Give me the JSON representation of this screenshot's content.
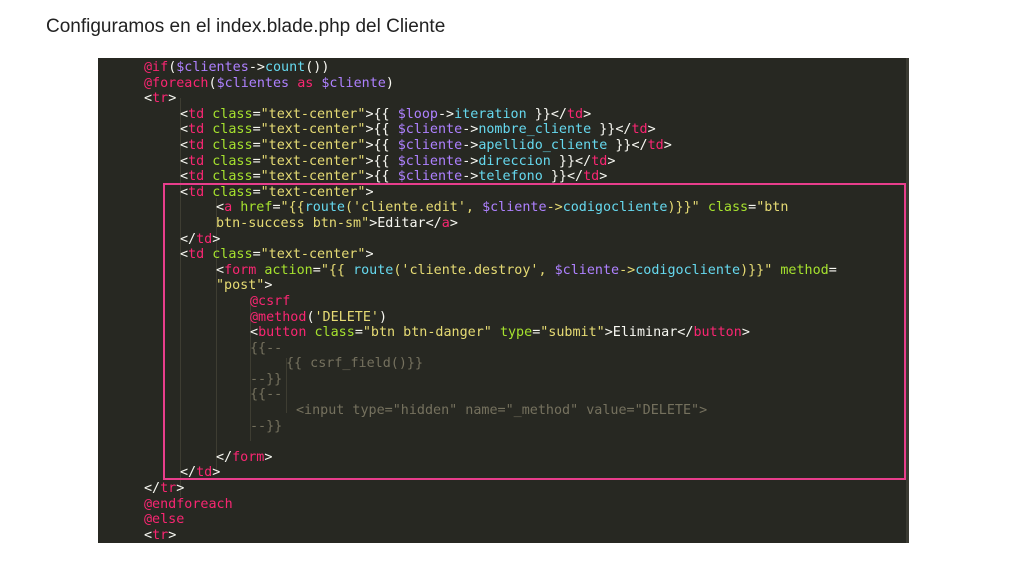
{
  "title": "Configuramos en el index.blade.php del Cliente",
  "colors": {
    "editor_bg": "#272822",
    "plain": "#f8f8f2",
    "keyword": "#f92672",
    "string": "#e6db74",
    "var": "#ae81ff",
    "attr": "#a6e22e",
    "func": "#66d9ef",
    "comment": "#75715e",
    "highlight_border": "#e83e8c"
  },
  "code": [
    {
      "indent": 46,
      "tokens": [
        [
          "keyword",
          "@if"
        ],
        [
          "plain",
          "("
        ],
        [
          "var",
          "$clientes"
        ],
        [
          "plain",
          "->"
        ],
        [
          "func",
          "count"
        ],
        [
          "plain",
          "())"
        ]
      ]
    },
    {
      "indent": 46,
      "tokens": [
        [
          "keyword",
          "@foreach"
        ],
        [
          "plain",
          "("
        ],
        [
          "var",
          "$clientes"
        ],
        [
          "plain",
          " "
        ],
        [
          "keyword",
          "as"
        ],
        [
          "plain",
          " "
        ],
        [
          "var",
          "$cliente"
        ],
        [
          "plain",
          ")"
        ]
      ]
    },
    {
      "indent": 46,
      "tokens": [
        [
          "plain",
          "<"
        ],
        [
          "tag",
          "tr"
        ],
        [
          "plain",
          ">"
        ]
      ]
    },
    {
      "indent": 82,
      "tokens": [
        [
          "plain",
          "<"
        ],
        [
          "tag",
          "td"
        ],
        [
          "plain",
          " "
        ],
        [
          "attr",
          "class"
        ],
        [
          "plain",
          "="
        ],
        [
          "string",
          "\"text-center\""
        ],
        [
          "plain",
          ">{{ "
        ],
        [
          "var",
          "$loop"
        ],
        [
          "plain",
          "->"
        ],
        [
          "func",
          "iteration"
        ],
        [
          "plain",
          " }}</"
        ],
        [
          "tag",
          "td"
        ],
        [
          "plain",
          ">"
        ]
      ]
    },
    {
      "indent": 82,
      "tokens": [
        [
          "plain",
          "<"
        ],
        [
          "tag",
          "td"
        ],
        [
          "plain",
          " "
        ],
        [
          "attr",
          "class"
        ],
        [
          "plain",
          "="
        ],
        [
          "string",
          "\"text-center\""
        ],
        [
          "plain",
          ">{{ "
        ],
        [
          "var",
          "$cliente"
        ],
        [
          "plain",
          "->"
        ],
        [
          "func",
          "nombre_cliente"
        ],
        [
          "plain",
          " }}</"
        ],
        [
          "tag",
          "td"
        ],
        [
          "plain",
          ">"
        ]
      ]
    },
    {
      "indent": 82,
      "tokens": [
        [
          "plain",
          "<"
        ],
        [
          "tag",
          "td"
        ],
        [
          "plain",
          " "
        ],
        [
          "attr",
          "class"
        ],
        [
          "plain",
          "="
        ],
        [
          "string",
          "\"text-center\""
        ],
        [
          "plain",
          ">{{ "
        ],
        [
          "var",
          "$cliente"
        ],
        [
          "plain",
          "->"
        ],
        [
          "func",
          "apellido_cliente"
        ],
        [
          "plain",
          " }}</"
        ],
        [
          "tag",
          "td"
        ],
        [
          "plain",
          ">"
        ]
      ]
    },
    {
      "indent": 82,
      "tokens": [
        [
          "plain",
          "<"
        ],
        [
          "tag",
          "td"
        ],
        [
          "plain",
          " "
        ],
        [
          "attr",
          "class"
        ],
        [
          "plain",
          "="
        ],
        [
          "string",
          "\"text-center\""
        ],
        [
          "plain",
          ">{{ "
        ],
        [
          "var",
          "$cliente"
        ],
        [
          "plain",
          "->"
        ],
        [
          "func",
          "direccion"
        ],
        [
          "plain",
          " }}</"
        ],
        [
          "tag",
          "td"
        ],
        [
          "plain",
          ">"
        ]
      ]
    },
    {
      "indent": 82,
      "tokens": [
        [
          "plain",
          "<"
        ],
        [
          "tag",
          "td"
        ],
        [
          "plain",
          " "
        ],
        [
          "attr",
          "class"
        ],
        [
          "plain",
          "="
        ],
        [
          "string",
          "\"text-center\""
        ],
        [
          "plain",
          ">{{ "
        ],
        [
          "var",
          "$cliente"
        ],
        [
          "plain",
          "->"
        ],
        [
          "func",
          "telefono"
        ],
        [
          "plain",
          " }}</"
        ],
        [
          "tag",
          "td"
        ],
        [
          "plain",
          ">"
        ]
      ]
    },
    {
      "indent": 82,
      "tokens": [
        [
          "plain",
          "<"
        ],
        [
          "tag",
          "td"
        ],
        [
          "plain",
          " "
        ],
        [
          "attr",
          "class"
        ],
        [
          "plain",
          "="
        ],
        [
          "string",
          "\"text-center\""
        ],
        [
          "plain",
          ">"
        ]
      ]
    },
    {
      "indent": 118,
      "tokens": [
        [
          "plain",
          "<"
        ],
        [
          "tag",
          "a"
        ],
        [
          "plain",
          " "
        ],
        [
          "attr",
          "href"
        ],
        [
          "plain",
          "="
        ],
        [
          "string",
          "\"{{"
        ],
        [
          "func",
          "route"
        ],
        [
          "string",
          "('cliente.edit', "
        ],
        [
          "var",
          "$cliente"
        ],
        [
          "string",
          "->"
        ],
        [
          "func",
          "codigocliente"
        ],
        [
          "string",
          ")}}\""
        ],
        [
          "plain",
          " "
        ],
        [
          "attr",
          "class"
        ],
        [
          "plain",
          "="
        ],
        [
          "string",
          "\"btn"
        ]
      ]
    },
    {
      "indent": 118,
      "tokens": [
        [
          "string",
          "btn-success btn-sm\""
        ],
        [
          "plain",
          ">Editar</"
        ],
        [
          "tag",
          "a"
        ],
        [
          "plain",
          ">"
        ]
      ]
    },
    {
      "indent": 82,
      "tokens": [
        [
          "plain",
          "</"
        ],
        [
          "tag",
          "td"
        ],
        [
          "plain",
          ">"
        ]
      ]
    },
    {
      "indent": 82,
      "tokens": [
        [
          "plain",
          "<"
        ],
        [
          "tag",
          "td"
        ],
        [
          "plain",
          " "
        ],
        [
          "attr",
          "class"
        ],
        [
          "plain",
          "="
        ],
        [
          "string",
          "\"text-center\""
        ],
        [
          "plain",
          ">"
        ]
      ]
    },
    {
      "indent": 118,
      "tokens": [
        [
          "plain",
          "<"
        ],
        [
          "tag",
          "form"
        ],
        [
          "plain",
          " "
        ],
        [
          "attr",
          "action"
        ],
        [
          "plain",
          "="
        ],
        [
          "string",
          "\"{{ "
        ],
        [
          "func",
          "route"
        ],
        [
          "string",
          "('cliente.destroy', "
        ],
        [
          "var",
          "$cliente"
        ],
        [
          "string",
          "->"
        ],
        [
          "func",
          "codigocliente"
        ],
        [
          "string",
          ")}}\""
        ],
        [
          "plain",
          " "
        ],
        [
          "attr",
          "method"
        ],
        [
          "plain",
          "="
        ]
      ]
    },
    {
      "indent": 118,
      "tokens": [
        [
          "string",
          "\"post\""
        ],
        [
          "plain",
          ">"
        ]
      ]
    },
    {
      "indent": 152,
      "tokens": [
        [
          "keyword",
          "@csrf"
        ]
      ]
    },
    {
      "indent": 152,
      "tokens": [
        [
          "keyword",
          "@method"
        ],
        [
          "plain",
          "("
        ],
        [
          "string",
          "'DELETE'"
        ],
        [
          "plain",
          ")"
        ]
      ]
    },
    {
      "indent": 152,
      "tokens": [
        [
          "plain",
          "<"
        ],
        [
          "tag",
          "button"
        ],
        [
          "plain",
          " "
        ],
        [
          "attr",
          "class"
        ],
        [
          "plain",
          "="
        ],
        [
          "string",
          "\"btn btn-danger\""
        ],
        [
          "plain",
          " "
        ],
        [
          "attr",
          "type"
        ],
        [
          "plain",
          "="
        ],
        [
          "string",
          "\"submit\""
        ],
        [
          "plain",
          ">Eliminar</"
        ],
        [
          "tag",
          "button"
        ],
        [
          "plain",
          ">"
        ]
      ]
    },
    {
      "indent": 152,
      "tokens": [
        [
          "comment",
          "{{--"
        ]
      ]
    },
    {
      "indent": 188,
      "tokens": [
        [
          "comment",
          "{{ csrf_field()}}"
        ]
      ]
    },
    {
      "indent": 152,
      "tokens": [
        [
          "comment",
          "--}}"
        ]
      ]
    },
    {
      "indent": 152,
      "tokens": [
        [
          "comment",
          "{{--"
        ]
      ]
    },
    {
      "indent": 198,
      "tokens": [
        [
          "comment",
          "<input type=\"hidden\" name=\"_method\" value=\"DELETE\">"
        ]
      ]
    },
    {
      "indent": 152,
      "tokens": [
        [
          "comment",
          "--}}"
        ]
      ]
    },
    {
      "indent": 152,
      "tokens": []
    },
    {
      "indent": 118,
      "tokens": [
        [
          "plain",
          "</"
        ],
        [
          "tag",
          "form"
        ],
        [
          "plain",
          ">"
        ]
      ]
    },
    {
      "indent": 82,
      "tokens": [
        [
          "plain",
          "</"
        ],
        [
          "tag",
          "td"
        ],
        [
          "plain",
          ">"
        ]
      ]
    },
    {
      "indent": 46,
      "tokens": [
        [
          "plain",
          "</"
        ],
        [
          "tag",
          "tr"
        ],
        [
          "plain",
          ">"
        ]
      ]
    },
    {
      "indent": 46,
      "tokens": [
        [
          "keyword",
          "@endforeach"
        ]
      ]
    },
    {
      "indent": 46,
      "tokens": [
        [
          "keyword",
          "@else"
        ]
      ]
    },
    {
      "indent": 46,
      "tokens": [
        [
          "plain",
          "<"
        ],
        [
          "tag",
          "tr"
        ],
        [
          "plain",
          ">"
        ]
      ]
    }
  ]
}
